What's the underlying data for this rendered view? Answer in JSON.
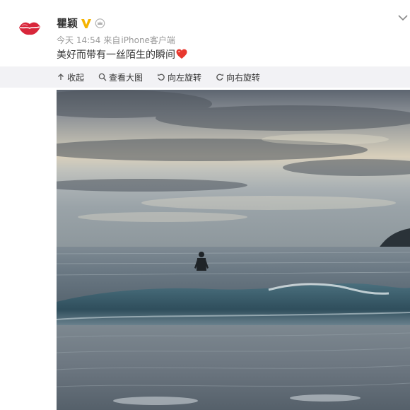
{
  "post": {
    "author": "瞿颖",
    "time": "今天 14:54",
    "source_prefix": "来自",
    "source": "iPhone客户端",
    "text": "美好而带有一丝陌生的瞬间"
  },
  "icons": {
    "avatar": "lips-icon",
    "verified": "verified-v-icon",
    "member": "crown-icon",
    "emoji": "heart-icon",
    "menu": "chevron-down-icon"
  },
  "toolbar": {
    "collapse_label": "收起",
    "view_label": "查看大图",
    "rotate_left_label": "向左旋转",
    "rotate_right_label": "向右旋转"
  },
  "colors": {
    "verified": "#f5b300",
    "heart": "#e8382f",
    "lips": "#d8263a",
    "toolbar_bg": "#f2f2f5"
  }
}
